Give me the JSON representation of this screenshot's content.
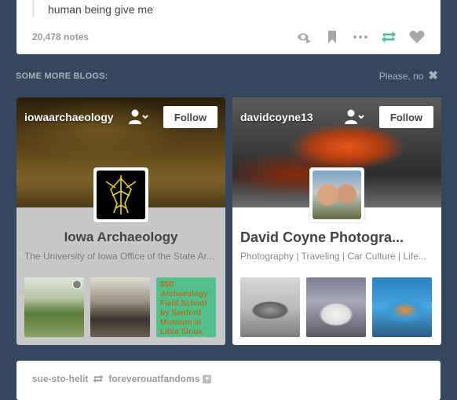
{
  "post": {
    "text": "human being give me",
    "notes": "20,478 notes"
  },
  "section": {
    "title": "SOME MORE BLOGS:",
    "dismiss": "Please, no"
  },
  "blogs": [
    {
      "username": "iowaarchaeology",
      "follow": "Follow",
      "title": "Iowa Archaeology",
      "description": "The University of Iowa Office of the State Ar...",
      "thumbs": [
        "",
        "",
        "$50 Archaeology Field School by Sanford Museum in Little Sioux"
      ]
    },
    {
      "username": "davidcoyne13",
      "follow": "Follow",
      "title": "David Coyne Photogra...",
      "description": "Photography | Traveling | Car Culture | Life..."
    }
  ],
  "next_post": {
    "reblogger": "sue-sto-helit",
    "source": "foreverouatfandoms"
  },
  "colors": {
    "background": "#36465d",
    "reblog_green": "#56bc8a",
    "muted_icon": "#a7a7a7"
  },
  "icons": [
    "dashboard-reply-icon",
    "bookmark-icon",
    "more-icon",
    "reblog-icon",
    "heart-icon",
    "close-icon",
    "person-dropdown-icon"
  ]
}
